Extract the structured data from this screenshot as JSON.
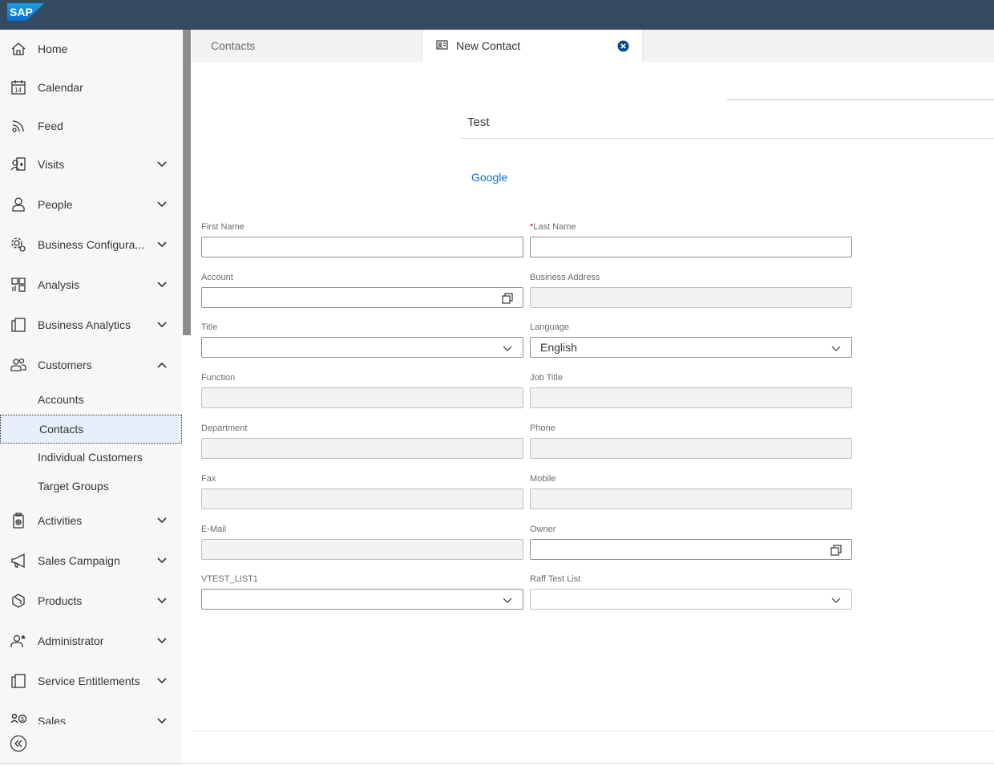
{
  "app": {
    "logo_text": "SAP",
    "brand_color": "#354a5f",
    "accent": "#0a6ed1"
  },
  "sidebar": {
    "items": [
      {
        "label": "Home",
        "icon": "home-icon"
      },
      {
        "label": "Calendar",
        "icon": "calendar-icon",
        "icon_text": "14"
      },
      {
        "label": "Feed",
        "icon": "feed-icon"
      },
      {
        "label": "Visits",
        "icon": "visits-icon"
      },
      {
        "label": "People",
        "icon": "person-icon"
      },
      {
        "label": "Business Configura...",
        "icon": "business-config-icon"
      },
      {
        "label": "Analysis",
        "icon": "analysis-icon"
      },
      {
        "label": "Business Analytics",
        "icon": "business-analytics-icon"
      },
      {
        "label": "Customers",
        "icon": "customers-icon"
      },
      {
        "label": "Activities",
        "icon": "activities-icon"
      },
      {
        "label": "Sales Campaign",
        "icon": "megaphone-icon"
      },
      {
        "label": "Products",
        "icon": "products-icon"
      },
      {
        "label": "Administrator",
        "icon": "administrator-icon"
      },
      {
        "label": "Service Entitlements",
        "icon": "service-entitlements-icon"
      },
      {
        "label": "Sales",
        "icon": "sales-icon"
      }
    ],
    "customers_sub": [
      {
        "label": "Accounts"
      },
      {
        "label": "Contacts",
        "selected": true
      },
      {
        "label": "Individual Customers"
      },
      {
        "label": "Target Groups"
      }
    ]
  },
  "tabs": [
    {
      "label": "Contacts"
    },
    {
      "label": "New Contact",
      "active": true
    }
  ],
  "record": {
    "title": "Test",
    "link": "Google"
  },
  "form": {
    "first_name": {
      "label": "First Name",
      "value": ""
    },
    "last_name": {
      "label": "Last Name",
      "required_mark": "*",
      "value": ""
    },
    "account": {
      "label": "Account",
      "value": ""
    },
    "business_address": {
      "label": "Business Address",
      "value": ""
    },
    "title": {
      "label": "Title",
      "value": ""
    },
    "language": {
      "label": "Language",
      "value": "English"
    },
    "function": {
      "label": "Function",
      "value": ""
    },
    "job_title": {
      "label": "Job Title",
      "value": ""
    },
    "department": {
      "label": "Department",
      "value": ""
    },
    "phone": {
      "label": "Phone",
      "value": ""
    },
    "fax": {
      "label": "Fax",
      "value": ""
    },
    "mobile": {
      "label": "Mobile",
      "value": ""
    },
    "email": {
      "label": "E-Mail",
      "value": ""
    },
    "owner": {
      "label": "Owner",
      "value": ""
    },
    "vtest_list1": {
      "label": "VTEST_LIST1",
      "value": ""
    },
    "raff_test_list": {
      "label": "Raff Test List",
      "value": ""
    }
  }
}
